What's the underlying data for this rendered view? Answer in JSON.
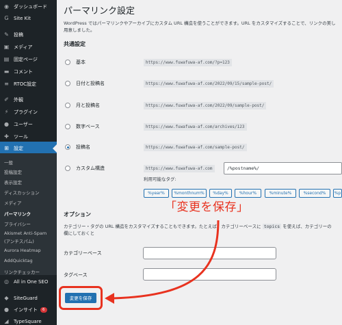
{
  "sidebar": {
    "items": [
      {
        "label": "ダッシュボード",
        "icon": "dashboard-icon"
      },
      {
        "label": "Site Kit",
        "icon": "sitekit-icon"
      },
      {
        "label": "投稿",
        "icon": "pin-icon"
      },
      {
        "label": "メディア",
        "icon": "media-icon"
      },
      {
        "label": "固定ページ",
        "icon": "page-icon"
      },
      {
        "label": "コメント",
        "icon": "comment-icon"
      },
      {
        "label": "RTOC設定",
        "icon": "list-icon"
      },
      {
        "label": "外観",
        "icon": "brush-icon"
      },
      {
        "label": "プラグイン",
        "icon": "plugin-icon"
      },
      {
        "label": "ユーザー",
        "icon": "user-icon"
      },
      {
        "label": "ツール",
        "icon": "wrench-icon"
      },
      {
        "label": "設定",
        "icon": "settings-icon"
      }
    ],
    "submenu": [
      "一般",
      "投稿設定",
      "表示設定",
      "ディスカッション",
      "メディア",
      "パーマリンク",
      "プライバシー",
      "Akismet Anti-Spam",
      "(アンチスパム)",
      "Aurora Heatmap",
      "AddQuicktag",
      "リンクチェッカー"
    ],
    "bottom": [
      {
        "label": "All in One SEO",
        "icon": "seo-icon"
      },
      {
        "label": "SiteGuard",
        "icon": "shield-icon"
      },
      {
        "label": "インサイト",
        "icon": "insight-icon",
        "badge": "6"
      },
      {
        "label": "TypeSquare",
        "icon": "type-icon"
      }
    ]
  },
  "page": {
    "title": "パーマリンク設定",
    "intro_line1": "WordPress ではパーマリンクやアーカイブにカスタム URL 構造を使うことができます。URL をカスタマイズすることで、リンクの美し",
    "intro_line2": "用意しました。",
    "common_heading": "共通設定",
    "options": [
      {
        "label": "基本",
        "example": "https://www.fuwafuwa-af.com/?p=123"
      },
      {
        "label": "日付と投稿名",
        "example": "https://www.fuwafuwa-af.com/2022/09/15/sample-post/"
      },
      {
        "label": "月と投稿名",
        "example": "https://www.fuwafuwa-af.com/2022/09/sample-post/"
      },
      {
        "label": "数字ベース",
        "example": "https://www.fuwafuwa-af.com/archives/123"
      },
      {
        "label": "投稿名",
        "example": "https://www.fuwafuwa-af.com/sample-post/"
      },
      {
        "label": "カスタム構造",
        "example": "https://www.fuwafuwa-af.com"
      }
    ],
    "selected_option": "投稿名",
    "custom_value": "/%postname%/",
    "tags_label": "利用可能なタグ:",
    "tags": [
      "%year%",
      "%monthnum%",
      "%day%",
      "%hour%",
      "%minute%",
      "%second%",
      "%p"
    ],
    "option_heading": "オプション",
    "desc_line1_a": "カテゴリー・タグの URL 構造をカスタマイズすることもできます。たとえば、カテゴリーベースに",
    "desc_code": "topics",
    "desc_line1_b": "を使えば、カテゴリーの",
    "desc_line2": "欄にしておくと",
    "category_base_label": "カテゴリーベース",
    "category_base_value": "",
    "tag_base_label": "タグベース",
    "tag_base_value": "",
    "save_label": "変更を保存"
  },
  "annotation": {
    "text": "「変更を保存」",
    "color": "#e8321f"
  },
  "colors": {
    "sidebar_bg": "#1d2327",
    "accent": "#2271b1",
    "highlight": "#e8321f"
  }
}
